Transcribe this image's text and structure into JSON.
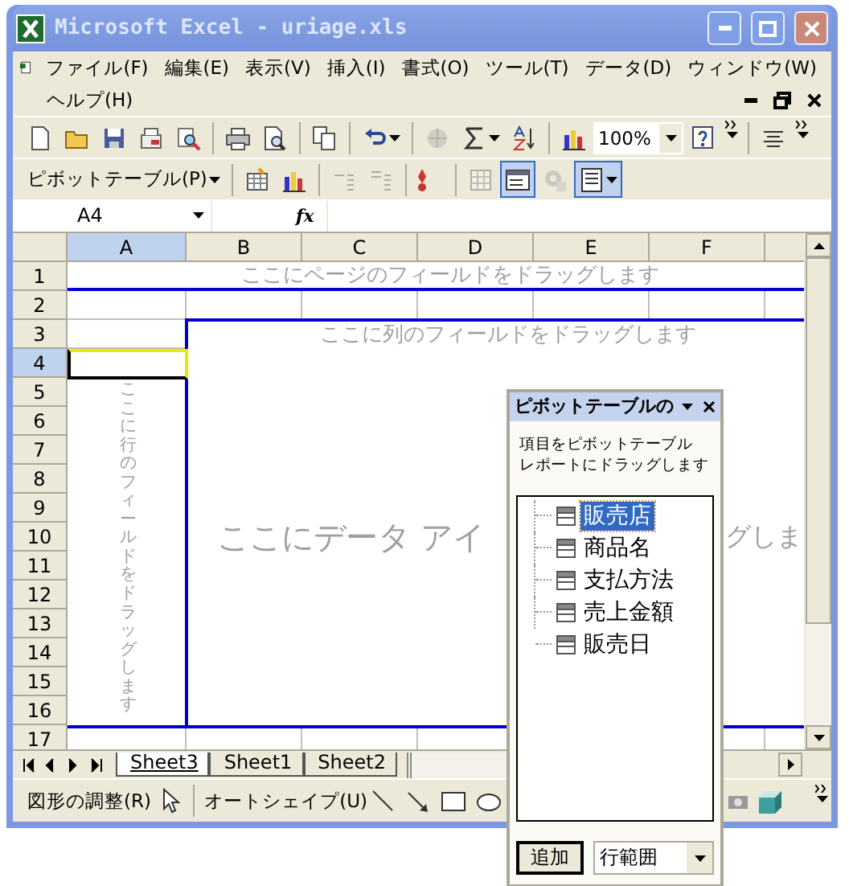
{
  "window": {
    "title": "Microsoft Excel - uriage.xls"
  },
  "menu_rows": [
    [
      "ファイル(F)",
      "編集(E)",
      "表示(V)",
      "挿入(I)",
      "書式(O)",
      "ツール(T)",
      "データ(D)",
      "ウィンドウ(W)"
    ],
    [
      "ヘルプ(H)"
    ]
  ],
  "standard_toolbar": [
    {
      "kind": "new",
      "disabled": false
    },
    {
      "kind": "open",
      "disabled": false
    },
    {
      "kind": "save",
      "disabled": false
    },
    {
      "kind": "permission",
      "disabled": false
    },
    {
      "kind": "research",
      "disabled": false
    },
    {
      "kind": "sep"
    },
    {
      "kind": "print",
      "disabled": false
    },
    {
      "kind": "preview",
      "disabled": false
    },
    {
      "kind": "sep"
    },
    {
      "kind": "copy",
      "disabled": false
    },
    {
      "kind": "sep"
    },
    {
      "kind": "undo",
      "disabled": false
    },
    {
      "kind": "sep"
    },
    {
      "kind": "hyperlink",
      "disabled": true
    },
    {
      "kind": "sum",
      "disabled": false
    },
    {
      "kind": "sort",
      "disabled": false
    },
    {
      "kind": "sep"
    },
    {
      "kind": "chart",
      "disabled": false
    },
    {
      "kind": "zoom",
      "value": "100%"
    },
    {
      "kind": "help",
      "disabled": false
    },
    {
      "kind": "more"
    },
    {
      "kind": "sep"
    },
    {
      "kind": "align",
      "disabled": false
    },
    {
      "kind": "more"
    }
  ],
  "pivot_toolbar": [
    {
      "kind": "menu",
      "label": "ピボットテーブル(P)"
    },
    {
      "kind": "sep"
    },
    {
      "kind": "format",
      "disabled": false
    },
    {
      "kind": "chart",
      "disabled": false
    },
    {
      "kind": "sep"
    },
    {
      "kind": "hide",
      "disabled": true
    },
    {
      "kind": "show",
      "disabled": true
    },
    {
      "kind": "sep"
    },
    {
      "kind": "refresh",
      "disabled": false
    },
    {
      "kind": "sep"
    },
    {
      "kind": "grid",
      "disabled": true,
      "pressed": false
    },
    {
      "kind": "fieldlist",
      "disabled": false,
      "pressed": true
    },
    {
      "kind": "settings",
      "disabled": true,
      "pressed": false
    },
    {
      "kind": "panel",
      "disabled": false,
      "pressed": true
    }
  ],
  "name_box": "A4",
  "formula_label": "fx",
  "columns": [
    {
      "label": "A",
      "selected": true
    },
    {
      "label": "B",
      "selected": false
    },
    {
      "label": "C",
      "selected": false
    },
    {
      "label": "D",
      "selected": false
    },
    {
      "label": "E",
      "selected": false
    },
    {
      "label": "F",
      "selected": false
    }
  ],
  "rows": [
    {
      "label": "1",
      "selected": false
    },
    {
      "label": "2",
      "selected": false
    },
    {
      "label": "3",
      "selected": false
    },
    {
      "label": "4",
      "selected": true
    },
    {
      "label": "5",
      "selected": false
    },
    {
      "label": "6",
      "selected": false
    },
    {
      "label": "7",
      "selected": false
    },
    {
      "label": "8",
      "selected": false
    },
    {
      "label": "9",
      "selected": false
    },
    {
      "label": "10",
      "selected": false
    },
    {
      "label": "11",
      "selected": false
    },
    {
      "label": "12",
      "selected": false
    },
    {
      "label": "13",
      "selected": false
    },
    {
      "label": "14",
      "selected": false
    },
    {
      "label": "15",
      "selected": false
    },
    {
      "label": "16",
      "selected": false
    },
    {
      "label": "17",
      "selected": false
    }
  ],
  "pivot_areas": {
    "page": "ここにページのフィールドをドラッグします",
    "column": "ここに列のフィールドをドラッグします",
    "row": "ここに行のフィールドをドラッグします",
    "data_left": "ここにデータ アイ",
    "data_right": "グしま"
  },
  "sheet_tabs": [
    {
      "label": "Sheet3",
      "selected": true
    },
    {
      "label": "Sheet1",
      "selected": false
    },
    {
      "label": "Sheet2",
      "selected": false
    }
  ],
  "drawing_toolbar": [
    {
      "kind": "menu",
      "label": "図形の調整(R)"
    },
    {
      "kind": "pointer"
    },
    {
      "kind": "sep"
    },
    {
      "kind": "menu",
      "label": "オートシェイプ(U)"
    },
    {
      "kind": "line"
    },
    {
      "kind": "arrow"
    },
    {
      "kind": "rect"
    },
    {
      "kind": "oval"
    }
  ],
  "field_list": {
    "title": "ピボットテーブルの",
    "instruction": [
      "項目をピボットテーブル",
      "レポートにドラッグします"
    ],
    "fields": [
      {
        "label": "販売店",
        "selected": true
      },
      {
        "label": "商品名",
        "selected": false
      },
      {
        "label": "支払方法",
        "selected": false
      },
      {
        "label": "売上金額",
        "selected": false
      },
      {
        "label": "販売日",
        "selected": false
      }
    ],
    "add_button": "追加",
    "area": "行範囲"
  }
}
